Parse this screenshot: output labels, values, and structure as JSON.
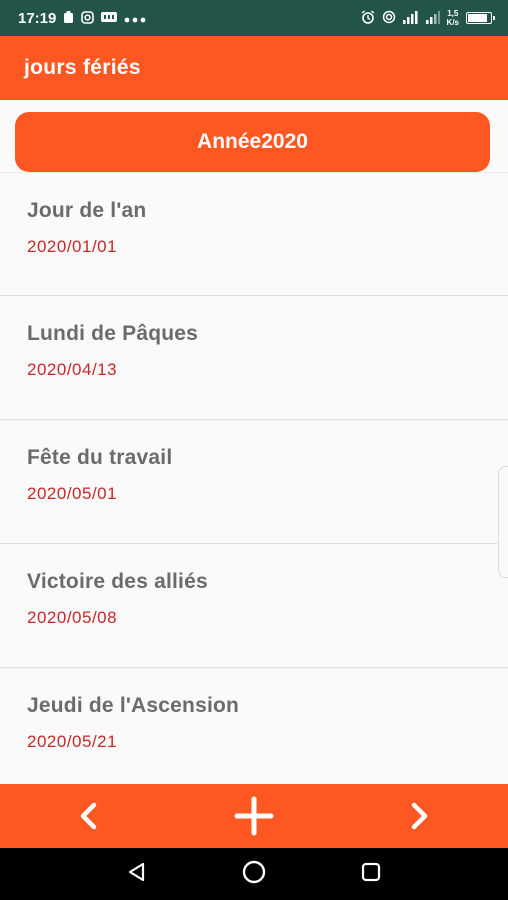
{
  "status_bar": {
    "time": "17:19",
    "network_speed_value": "1,5",
    "network_speed_unit": "K/s",
    "left_icons": [
      "notification-icon",
      "instagram-icon",
      "app-icon",
      "more-dots-icon"
    ],
    "right_icons": [
      "alarm-icon",
      "hotspot-icon",
      "signal-icon",
      "signal-icon",
      "battery-icon"
    ]
  },
  "app_bar": {
    "title": "jours fériés"
  },
  "year_button": {
    "label": "Année2020"
  },
  "holidays": [
    {
      "name": "Jour de l'an",
      "date": "2020/01/01"
    },
    {
      "name": "Lundi de Pâques",
      "date": "2020/04/13"
    },
    {
      "name": "Fête du travail",
      "date": "2020/05/01"
    },
    {
      "name": "Victoire des alliés",
      "date": "2020/05/08"
    },
    {
      "name": "Jeudi de l'Ascension",
      "date": "2020/05/21"
    }
  ],
  "bottom_bar": {
    "icons": [
      "chevron-left-icon",
      "plus-icon",
      "chevron-right-icon"
    ]
  },
  "nav_bar": {
    "icons": [
      "back-triangle-icon",
      "home-circle-icon",
      "recents-square-icon"
    ]
  },
  "colors": {
    "status_bar": "#23544a",
    "accent": "#ff5722",
    "date_text": "#c62828",
    "name_text": "#6b6b6b"
  }
}
